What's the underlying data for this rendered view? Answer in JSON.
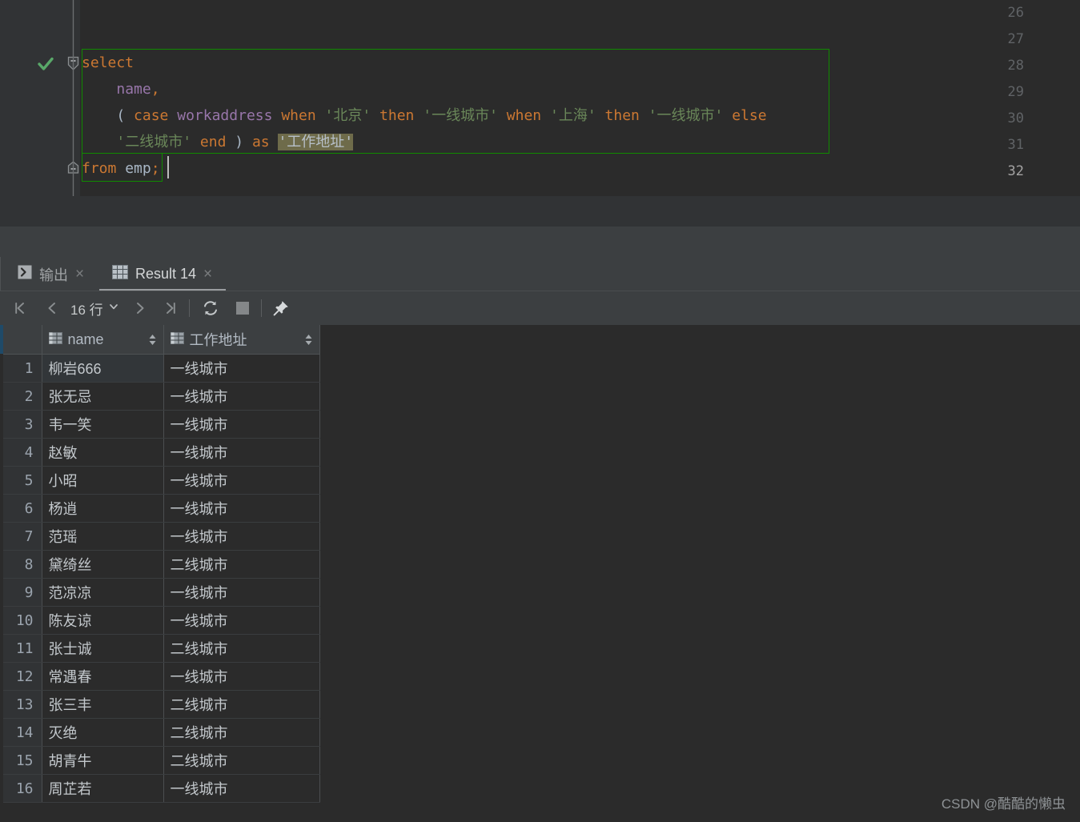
{
  "editor": {
    "lines": [
      {
        "num": "26",
        "segments": []
      },
      {
        "num": "27",
        "segments": []
      },
      {
        "num": "28",
        "segments": []
      },
      {
        "num": "29",
        "segments": []
      },
      {
        "num": "30",
        "segments": []
      },
      {
        "num": "31",
        "segments": []
      },
      {
        "num": "32",
        "segments": []
      }
    ],
    "line_numbers": [
      "26",
      "27",
      "28",
      "29",
      "30",
      "31",
      "32"
    ],
    "current_line": "32",
    "code_text_28": "select",
    "code_text_29": "    name,",
    "code_text_30": "    ( case workaddress when '北京' then '一线城市' when '上海' then '一线城市' else",
    "code_text_31": "    '二线城市' end ) as '工作地址'",
    "code_text_32": "from emp;",
    "tokens": {
      "select": "select",
      "name": "name",
      "comma": ",",
      "open_paren": "(",
      "case": "case",
      "workaddress": "workaddress",
      "when1": "when",
      "beijing": "'北京'",
      "then1": "then",
      "tier1_a": "'一线城市'",
      "when2": "when",
      "shanghai": "'上海'",
      "then2": "then",
      "tier1_b": "'一线城市'",
      "else": "else",
      "tier2": "'二线城市'",
      "end": "end",
      "close_paren": ")",
      "as": "as",
      "alias": "'工作地址'",
      "from": "from",
      "emp": "emp",
      "semicolon": ";"
    },
    "gutter": {
      "inspection_status_icon": "check-icon",
      "fold_open_icon": "fold-collapse-icon",
      "fold_single_icon": "fold-single-icon"
    },
    "colors": {
      "background": "#2b2b2b",
      "gutter": "#313335",
      "keyword": "#cc7832",
      "identifier": "#9876aa",
      "string": "#6a8759",
      "default_text": "#a9b7c6",
      "statement_box_border": "#108a00",
      "highlight_background": "#6e6b4a"
    }
  },
  "toolwindow": {
    "tabs": [
      {
        "label": "输出",
        "icon": "console-output-icon",
        "active": false,
        "close": "×"
      },
      {
        "label": "Result 14",
        "icon": "result-grid-icon",
        "active": true,
        "close": "×"
      }
    ],
    "toolbar": {
      "first_page": "first-page-icon",
      "prev_page": "prev-page-icon",
      "rows_label": "16 行",
      "rows_dropdown": "chevron-down-icon",
      "next_page": "next-page-icon",
      "last_page": "last-page-icon",
      "reload": "refresh-icon",
      "stop": "stop-icon",
      "pin": "pin-icon"
    }
  },
  "result_grid": {
    "columns": [
      {
        "label": "name",
        "icon": "column-grid-icon",
        "sort": "sort-indicator-icon"
      },
      {
        "label": "工作地址",
        "icon": "column-grid-icon",
        "sort": "sort-indicator-icon"
      }
    ],
    "rows": [
      {
        "n": "1",
        "name": "柳岩666",
        "addr": "一线城市"
      },
      {
        "n": "2",
        "name": "张无忌",
        "addr": "一线城市"
      },
      {
        "n": "3",
        "name": "韦一笑",
        "addr": "一线城市"
      },
      {
        "n": "4",
        "name": "赵敏",
        "addr": "一线城市"
      },
      {
        "n": "5",
        "name": "小昭",
        "addr": "一线城市"
      },
      {
        "n": "6",
        "name": "杨逍",
        "addr": "一线城市"
      },
      {
        "n": "7",
        "name": "范瑶",
        "addr": "一线城市"
      },
      {
        "n": "8",
        "name": "黛绮丝",
        "addr": "二线城市"
      },
      {
        "n": "9",
        "name": "范凉凉",
        "addr": "一线城市"
      },
      {
        "n": "10",
        "name": "陈友谅",
        "addr": "一线城市"
      },
      {
        "n": "11",
        "name": "张士诚",
        "addr": "二线城市"
      },
      {
        "n": "12",
        "name": "常遇春",
        "addr": "一线城市"
      },
      {
        "n": "13",
        "name": "张三丰",
        "addr": "二线城市"
      },
      {
        "n": "14",
        "name": "灭绝",
        "addr": "二线城市"
      },
      {
        "n": "15",
        "name": "胡青牛",
        "addr": "二线城市"
      },
      {
        "n": "16",
        "name": "周芷若",
        "addr": "一线城市"
      }
    ]
  },
  "watermark": "CSDN @酷酷的懒虫"
}
